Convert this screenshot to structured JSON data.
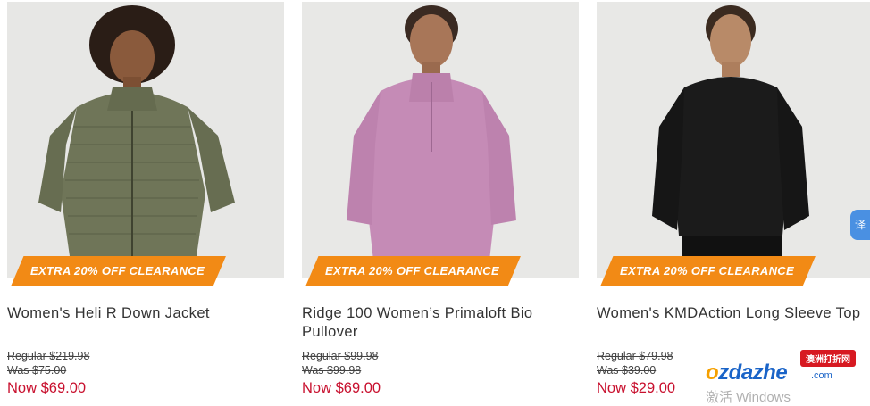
{
  "colors": {
    "badge": "#f28a15",
    "sale_price": "#c8102e",
    "text": "#333333"
  },
  "products": [
    {
      "badge": "EXTRA 20% OFF CLEARANCE",
      "name": "Women's Heli R Down Jacket",
      "regular": "Regular $219.98",
      "was": "Was $75.00",
      "now": "Now $69.00",
      "image": "model-olive-down-jacket"
    },
    {
      "badge": "EXTRA 20% OFF CLEARANCE",
      "name": "Ridge 100 Women’s Primaloft Bio Pullover",
      "regular": "Regular $99.98",
      "was": "Was $99.98",
      "now": "Now $69.00",
      "image": "model-pink-fleece-pullover"
    },
    {
      "badge": "EXTRA 20% OFF CLEARANCE",
      "name": "Women's KMDAction Long Sleeve Top",
      "regular": "Regular $79.98",
      "was": "Was $39.00",
      "now": "Now $29.00",
      "image": "model-black-long-sleeve-top"
    }
  ],
  "side_tab": {
    "label": "译",
    "icon": "translate-icon"
  },
  "watermark": {
    "label": "澳洲打折网",
    "logo_o": "o",
    "logo_rest": "zdazhe",
    "com": ".com"
  },
  "os_overlay": {
    "text": "激活 Windows"
  }
}
